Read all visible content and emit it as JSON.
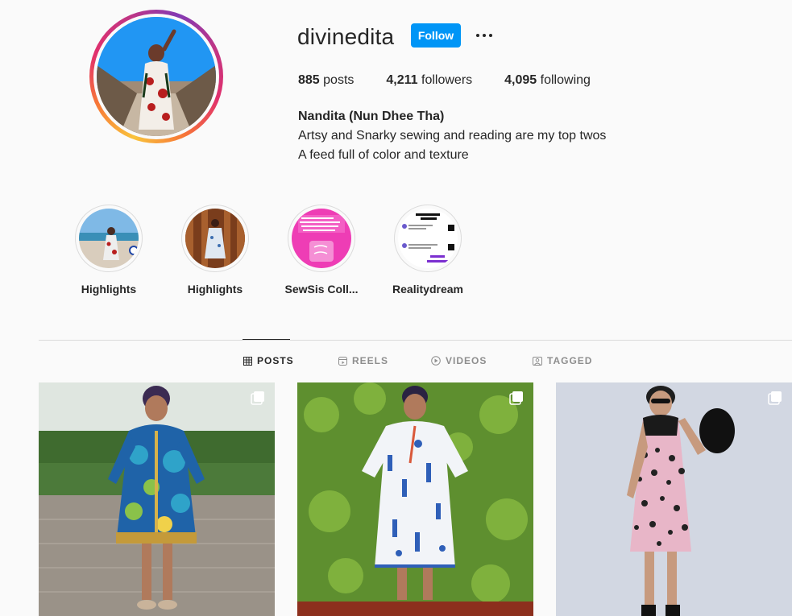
{
  "profile": {
    "username": "divinedita",
    "follow_label": "Follow",
    "more_options": "more-options-icon",
    "stats": {
      "posts_count": "885",
      "posts_label": "posts",
      "followers_count": "4,211",
      "followers_label": "followers",
      "following_count": "4,095",
      "following_label": "following"
    },
    "full_name": "Nandita (Nun Dhee Tha)",
    "bio_line1": "Artsy and Snarky sewing and reading are my top twos",
    "bio_line2": "A feed full of color and texture"
  },
  "highlights": [
    {
      "label": "Highlights"
    },
    {
      "label": "Highlights"
    },
    {
      "label": "SewSis Coll..."
    },
    {
      "label": "Realitydream"
    }
  ],
  "tabs": [
    {
      "label": "POSTS",
      "active": true,
      "icon": "grid-icon"
    },
    {
      "label": "REELS",
      "active": false,
      "icon": "reels-icon"
    },
    {
      "label": "VIDEOS",
      "active": false,
      "icon": "play-icon"
    },
    {
      "label": "TAGGED",
      "active": false,
      "icon": "tag-icon"
    }
  ],
  "posts": [
    {
      "type": "carousel",
      "icon": "multiple-photos-icon"
    },
    {
      "type": "carousel",
      "icon": "multiple-photos-icon"
    },
    {
      "type": "carousel",
      "icon": "multiple-photos-icon"
    }
  ],
  "colors": {
    "follow_button": "#0095f6",
    "text": "#262626",
    "muted": "#8e8e8e",
    "border": "#dbdbdb",
    "background": "#fafafa"
  }
}
